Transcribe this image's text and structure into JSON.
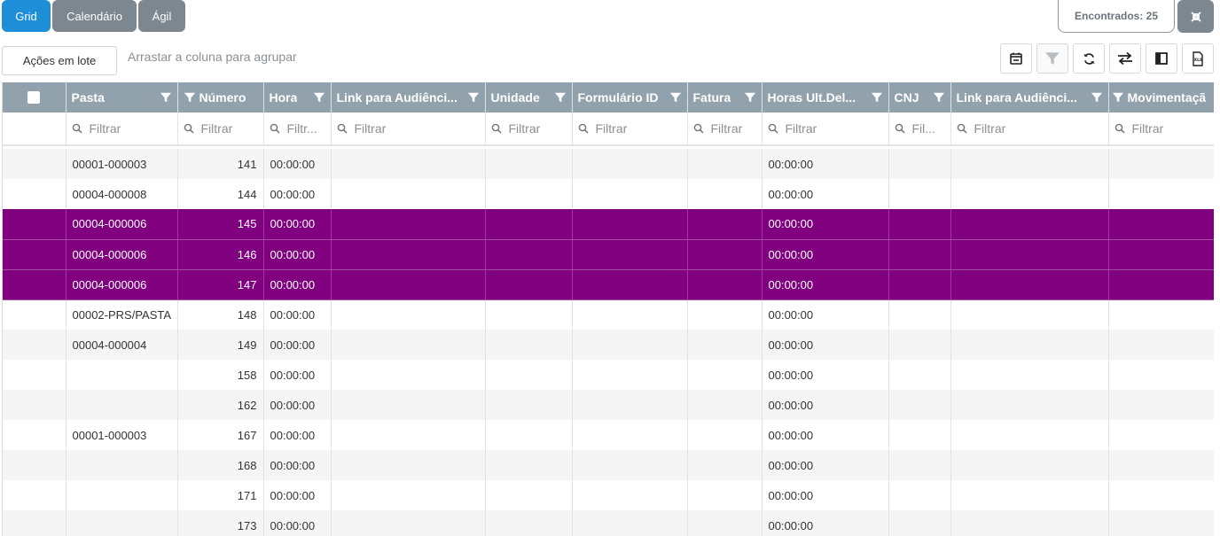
{
  "tabs": [
    "Grid",
    "Calendário",
    "Ágil"
  ],
  "found_label": "Encontrados: 25",
  "actions_label": "Ações em lote",
  "group_hint": "Arrastar a coluna para agrupar",
  "columns": [
    "Pasta",
    "Número",
    "Hora",
    "Link para Audiênci...",
    "Unidade",
    "Formulário ID",
    "Fatura",
    "Horas Ult.Del...",
    "CNJ",
    "Link para Audiênci...",
    "Movimentaçã"
  ],
  "filters": [
    "Filtrar",
    "Filtrar",
    "Filtr...",
    "Filtrar",
    "Filtrar",
    "Filtrar",
    "Filtrar",
    "Filtrar",
    "Fil...",
    "Filtrar",
    "Filtrar"
  ],
  "rows": [
    {
      "pasta": "00001-000003",
      "numero": "141",
      "hora": "00:00:00",
      "horas": "00:00:00",
      "selected": false
    },
    {
      "pasta": "00004-000008",
      "numero": "144",
      "hora": "00:00:00",
      "horas": "00:00:00",
      "selected": false
    },
    {
      "pasta": "00004-000006",
      "numero": "145",
      "hora": "00:00:00",
      "horas": "00:00:00",
      "selected": true
    },
    {
      "pasta": "00004-000006",
      "numero": "146",
      "hora": "00:00:00",
      "horas": "00:00:00",
      "selected": true
    },
    {
      "pasta": "00004-000006",
      "numero": "147",
      "hora": "00:00:00",
      "horas": "00:00:00",
      "selected": true
    },
    {
      "pasta": "00002-PRS/PASTA",
      "numero": "148",
      "hora": "00:00:00",
      "horas": "00:00:00",
      "selected": false
    },
    {
      "pasta": "00004-000004",
      "numero": "149",
      "hora": "00:00:00",
      "horas": "00:00:00",
      "selected": false
    },
    {
      "pasta": "",
      "numero": "158",
      "hora": "00:00:00",
      "horas": "00:00:00",
      "selected": false
    },
    {
      "pasta": "",
      "numero": "162",
      "hora": "00:00:00",
      "horas": "00:00:00",
      "selected": false
    },
    {
      "pasta": "00001-000003",
      "numero": "167",
      "hora": "00:00:00",
      "horas": "00:00:00",
      "selected": false
    },
    {
      "pasta": "",
      "numero": "168",
      "hora": "00:00:00",
      "horas": "00:00:00",
      "selected": false
    },
    {
      "pasta": "",
      "numero": "171",
      "hora": "00:00:00",
      "horas": "00:00:00",
      "selected": false
    },
    {
      "pasta": "",
      "numero": "173",
      "hora": "00:00:00",
      "horas": "00:00:00",
      "selected": false
    }
  ],
  "toolbar_icons": [
    "calendar-icon",
    "filter-icon",
    "refresh-icon",
    "swap-icon",
    "column-chooser-icon",
    "export-xlsx-icon"
  ],
  "colors": {
    "accent": "#1f8ed8",
    "tab_inactive": "#7d8790",
    "header": "#92a2ac",
    "selected_row": "#800080"
  }
}
